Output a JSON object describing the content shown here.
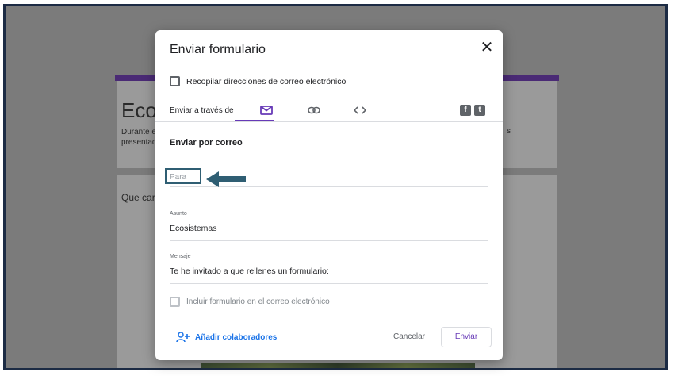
{
  "background": {
    "form_title": "Ecos",
    "description_lines": [
      "Durante es",
      "presentad"
    ],
    "description_right": "s",
    "question": "Que cara"
  },
  "dialog": {
    "title": "Enviar formulario",
    "close_icon": "close-icon",
    "collect_emails_label": "Recopilar direcciones de correo electrónico",
    "send_via_label": "Enviar a través de",
    "tabs": [
      {
        "name": "email",
        "icon": "mail-icon",
        "active": true
      },
      {
        "name": "link",
        "icon": "link-icon",
        "active": false
      },
      {
        "name": "embed",
        "icon": "code-icon",
        "active": false
      }
    ],
    "social": {
      "facebook": "f",
      "twitter": "t"
    },
    "section_title": "Enviar por correo",
    "to_placeholder": "Para",
    "subject_label": "Asunto",
    "subject_value": "Ecosistemas",
    "message_label": "Mensaje",
    "message_value": "Te he invitado a que rellenes un formulario:",
    "include_form_label": "Incluir formulario en el correo electrónico",
    "add_collaborators_label": "Añadir colaboradores",
    "cancel_label": "Cancelar",
    "send_label": "Enviar"
  },
  "colors": {
    "accent": "#673ab7",
    "arrow": "#2f5e73",
    "link": "#1a73e8"
  }
}
